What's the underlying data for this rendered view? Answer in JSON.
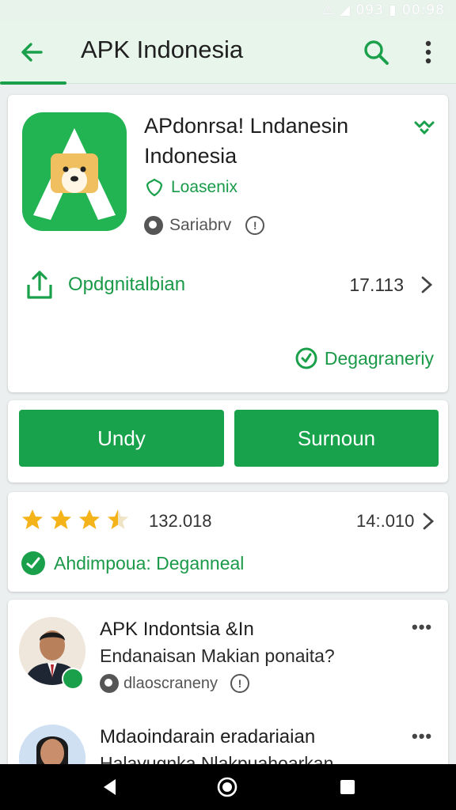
{
  "status_bar": {
    "text": "⚠ ◢ 093 ▮ 00:98"
  },
  "appbar": {
    "title": "APK Indonesia"
  },
  "app": {
    "name_line1": "APdonrsa! Lndanesin",
    "name_line2": "Indonesia",
    "developer": "Loasenix",
    "category": "Sariabrv"
  },
  "update": {
    "label": "Opdgnitalbian",
    "count": "17.113"
  },
  "safety": {
    "label": "Degagraneriy"
  },
  "buttons": {
    "left": "Undy",
    "right": "Surnoun"
  },
  "rating": {
    "stars": 3.5,
    "count": "132.018",
    "right_value": "14:.010",
    "badge": "Ahdimpoua: Deganneal"
  },
  "reviews": [
    {
      "title": "APK Indontsia &In",
      "subtitle": "Endanaisan Makian ponaita?",
      "meta": "dlaoscraneny"
    },
    {
      "title": "Mdaoindarain eradariaian",
      "subtitle": "Halayugnka Nlakpuahoarkan"
    }
  ],
  "colors": {
    "accent": "#17a24b",
    "appbar_bg": "#e8f5ea",
    "star": "#f5b31a"
  },
  "icons": {
    "back": "arrow-left-icon",
    "search": "search-icon",
    "more": "more-vert-icon",
    "heart": "heart-icon",
    "developer": "badge-icon",
    "category": "category-icon",
    "info": "info-icon",
    "update": "upload-icon",
    "safety": "shield-check-icon",
    "verified": "verified-icon",
    "nav_back": "nav-back-icon",
    "nav_home": "nav-home-icon",
    "nav_recent": "nav-recent-icon"
  }
}
